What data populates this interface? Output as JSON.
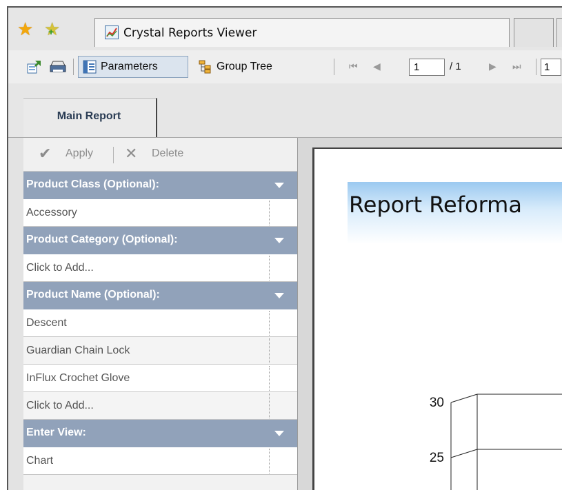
{
  "browser": {
    "tab_title": "Crystal Reports Viewer"
  },
  "toolbar": {
    "parameters_label": "Parameters",
    "group_tree_label": "Group Tree",
    "page_current": "1",
    "page_of": "/ 1",
    "zoom_value": "1"
  },
  "report_tabs": {
    "main": "Main Report"
  },
  "panel": {
    "apply_label": "Apply",
    "delete_label": "Delete",
    "params": [
      {
        "header": "Product Class (Optional):",
        "values": [
          "Accessory"
        ]
      },
      {
        "header": "Product Category (Optional):",
        "values": [
          "Click to Add..."
        ]
      },
      {
        "header": "Product Name (Optional):",
        "values": [
          "Descent",
          "Guardian Chain Lock",
          "InFlux Crochet Glove",
          "Click to Add..."
        ]
      },
      {
        "header": "Enter View:",
        "values": [
          "Chart"
        ]
      }
    ]
  },
  "report": {
    "title": "Report Reforma"
  },
  "chart_data": {
    "type": "bar",
    "title": "",
    "xlabel": "",
    "ylabel": "",
    "y_ticks": [
      30,
      25
    ],
    "categories": [],
    "values": []
  }
}
